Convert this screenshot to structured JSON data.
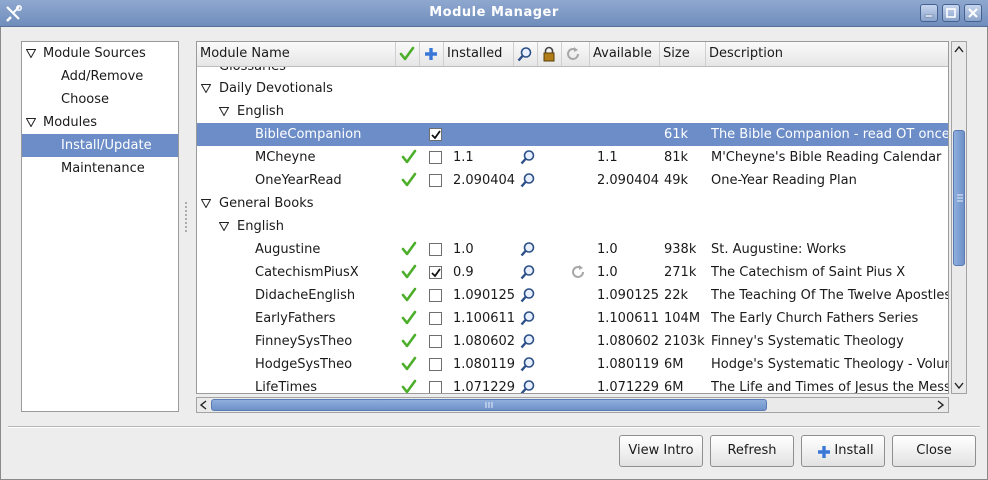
{
  "window": {
    "title": "Module Manager"
  },
  "tree": {
    "items": [
      {
        "label": "Module Sources",
        "expandable": true
      },
      {
        "label": "Add/Remove",
        "expandable": false
      },
      {
        "label": "Choose",
        "expandable": false
      },
      {
        "label": "Modules",
        "expandable": true
      },
      {
        "label": "Install/Update",
        "expandable": false,
        "selected": true
      },
      {
        "label": "Maintenance",
        "expandable": false
      }
    ]
  },
  "grid": {
    "columns": {
      "module_name": "Module Name",
      "installed": "Installed",
      "available": "Available",
      "size": "Size",
      "description": "Description"
    },
    "partial_top_row": "Glossaries",
    "groups": [
      {
        "label": "Daily Devotionals"
      },
      {
        "label": "English"
      },
      {
        "label": "General Books"
      },
      {
        "label": "English"
      }
    ],
    "modules": [
      {
        "name": "BibleCompanion",
        "ok": false,
        "checked": true,
        "installed": "",
        "search": false,
        "update": false,
        "available": "",
        "size": "61k",
        "description": "The Bible Companion - read OT once",
        "selected": true
      },
      {
        "name": "MCheyne",
        "ok": true,
        "checked": false,
        "installed": "1.1",
        "search": true,
        "update": false,
        "available": "1.1",
        "size": "81k",
        "description": "M'Cheyne's Bible Reading Calendar"
      },
      {
        "name": "OneYearRead",
        "ok": true,
        "checked": false,
        "installed": "2.090404",
        "search": true,
        "update": false,
        "available": "2.090404",
        "size": "49k",
        "description": "One-Year Reading Plan"
      },
      {
        "name": "Augustine",
        "ok": true,
        "checked": false,
        "installed": "1.0",
        "search": true,
        "update": false,
        "available": "1.0",
        "size": "938k",
        "description": "St. Augustine: Works"
      },
      {
        "name": "CatechismPiusX",
        "ok": true,
        "checked": true,
        "installed": "0.9",
        "search": true,
        "update": true,
        "available": "1.0",
        "size": "271k",
        "description": "The Catechism of Saint Pius X"
      },
      {
        "name": "DidacheEnglish",
        "ok": true,
        "checked": false,
        "installed": "1.090125",
        "search": true,
        "update": false,
        "available": "1.090125",
        "size": "22k",
        "description": "The Teaching Of The Twelve Apostles"
      },
      {
        "name": "EarlyFathers",
        "ok": true,
        "checked": false,
        "installed": "1.100611",
        "search": true,
        "update": false,
        "available": "1.100611",
        "size": "104M",
        "description": "The Early Church Fathers Series"
      },
      {
        "name": "FinneySysTheo",
        "ok": true,
        "checked": false,
        "installed": "1.080602",
        "search": true,
        "update": false,
        "available": "1.080602",
        "size": "2103k",
        "description": "Finney's Systematic Theology"
      },
      {
        "name": "HodgeSysTheo",
        "ok": true,
        "checked": false,
        "installed": "1.080119",
        "search": true,
        "update": false,
        "available": "1.080119",
        "size": "6M",
        "description": "Hodge's Systematic Theology - Volum"
      },
      {
        "name": "LifeTimes",
        "ok": true,
        "checked": false,
        "installed": "1.071229",
        "search": true,
        "update": false,
        "available": "1.071229",
        "size": "6M",
        "description": "The Life and Times of Jesus the Messi"
      }
    ]
  },
  "buttons": {
    "view_intro": "View Intro",
    "refresh": "Refresh",
    "install": "Install",
    "close": "Close"
  },
  "colors": {
    "selection": "#6c8dc8",
    "titlebar": "#7f9bc6",
    "check_green": "#4cae2a",
    "accent_blue": "#3a78d8"
  }
}
